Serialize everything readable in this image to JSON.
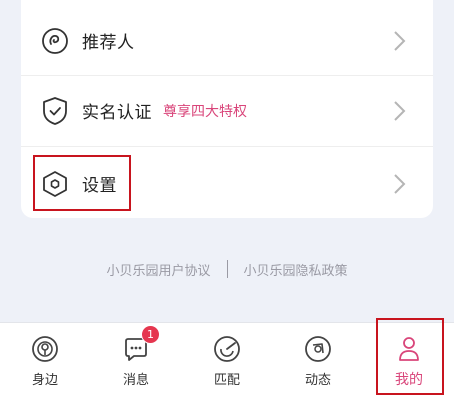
{
  "menu": {
    "items": [
      {
        "label": "推荐人",
        "icon": "referrer-icon"
      },
      {
        "label": "实名认证",
        "tag": "尊享四大特权",
        "icon": "shield-check-icon"
      },
      {
        "label": "设置",
        "icon": "settings-hexagon-icon"
      }
    ]
  },
  "footer_links": {
    "user_agreement": "小贝乐园用户协议",
    "privacy_policy": "小贝乐园隐私政策"
  },
  "tabbar": {
    "tabs": [
      {
        "label": "身边",
        "icon": "nearby-icon"
      },
      {
        "label": "消息",
        "icon": "message-icon",
        "badge": "1"
      },
      {
        "label": "匹配",
        "icon": "match-icon"
      },
      {
        "label": "动态",
        "icon": "moments-icon"
      },
      {
        "label": "我的",
        "icon": "profile-icon",
        "active": true
      }
    ]
  },
  "colors": {
    "accent": "#d9457a",
    "highlight_box": "#c8141e",
    "background": "#eef1f8"
  }
}
